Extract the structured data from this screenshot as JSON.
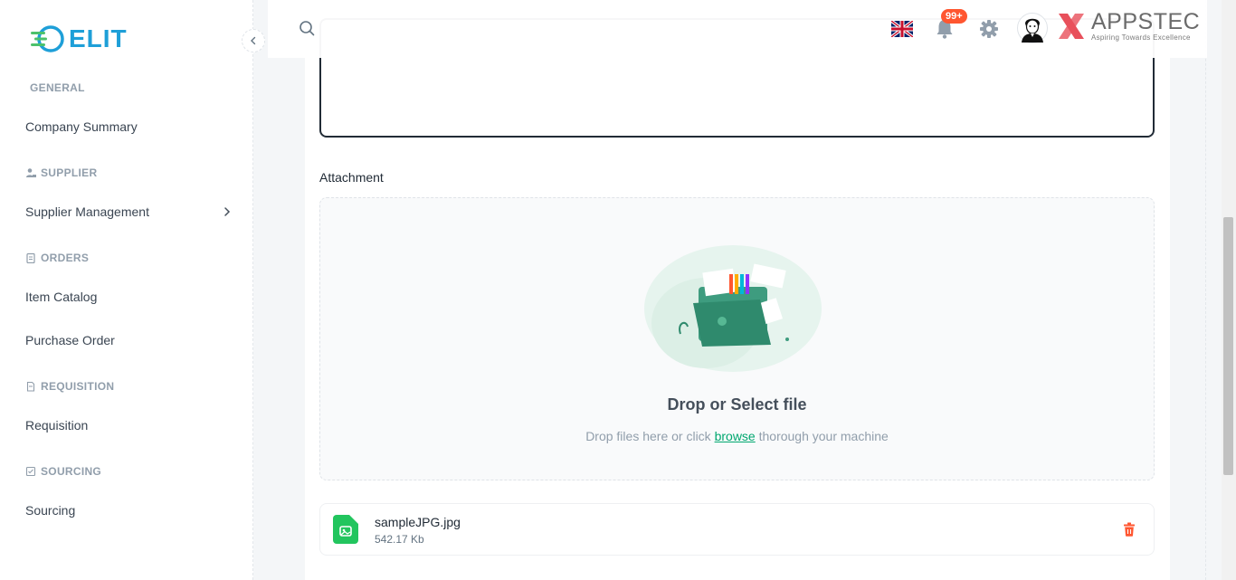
{
  "sidebar": {
    "logo_text": "ELIT",
    "sections": [
      {
        "title": "GENERAL",
        "icon": "none",
        "items": [
          {
            "label": "Company Summary"
          }
        ]
      },
      {
        "title": "SUPPLIER",
        "icon": "supplier-icon",
        "items": [
          {
            "label": "Supplier Management",
            "has_chevron": true
          }
        ]
      },
      {
        "title": "ORDERS",
        "icon": "clipboard-icon",
        "items": [
          {
            "label": "Item Catalog"
          },
          {
            "label": "Purchase Order"
          }
        ]
      },
      {
        "title": "REQUISITION",
        "icon": "document-icon",
        "items": [
          {
            "label": "Requisition"
          }
        ]
      },
      {
        "title": "SOURCING",
        "icon": "checklist-icon",
        "items": [
          {
            "label": "Sourcing"
          }
        ]
      }
    ]
  },
  "header": {
    "notification_count": "99+",
    "brand_name": "APPSTEC",
    "brand_tagline": "Aspiring Towards Excellence"
  },
  "form": {
    "attachment_label": "Attachment",
    "drop_title": "Drop or Select file",
    "drop_sub_before": "Drop files here or click",
    "drop_sub_link": "browse",
    "drop_sub_after": "thorough your machine"
  },
  "file": {
    "name": "sampleJPG.jpg",
    "size": "542.17 Kb"
  },
  "colors": {
    "accent": "#00a76f",
    "danger": "#ff5630",
    "logo_blue": "#1e9fd8"
  }
}
